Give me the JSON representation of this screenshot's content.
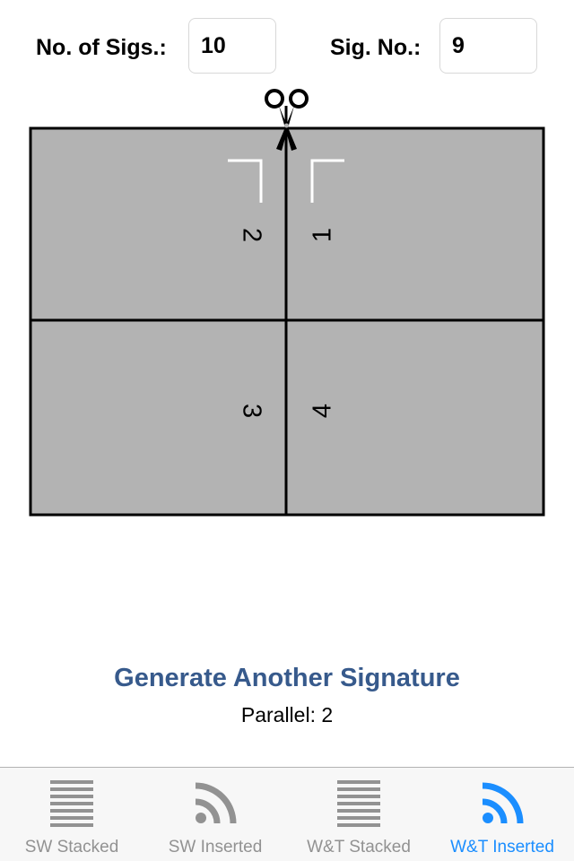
{
  "header": {
    "num_sigs_label": "No. of Sigs.:",
    "num_sigs_value": "10",
    "sig_no_label": "Sig. No.:",
    "sig_no_value": "9"
  },
  "diagram": {
    "cut_icon": "scissors-icon",
    "fold_marks": [
      "corner-mark-left",
      "corner-mark-right"
    ],
    "pages": [
      {
        "label": "2",
        "rotation": "90deg"
      },
      {
        "label": "1",
        "rotation": "-90deg"
      },
      {
        "label": "3",
        "rotation": "90deg"
      },
      {
        "label": "4",
        "rotation": "-90deg"
      }
    ],
    "sheet_color": "#b3b3b3"
  },
  "actions": {
    "generate_label": "Generate Another Signature",
    "parallel_text": "Parallel: 2"
  },
  "tabbar": {
    "tabs": [
      {
        "label": "SW Stacked",
        "icon": "stacked-lines-icon",
        "active": false
      },
      {
        "label": "SW Inserted",
        "icon": "inserted-arcs-icon",
        "active": false
      },
      {
        "label": "W&T Stacked",
        "icon": "stacked-lines-icon",
        "active": false
      },
      {
        "label": "W&T Inserted",
        "icon": "inserted-arcs-icon",
        "active": true
      }
    ],
    "active_color": "#1b8eff",
    "inactive_color": "#929292"
  }
}
